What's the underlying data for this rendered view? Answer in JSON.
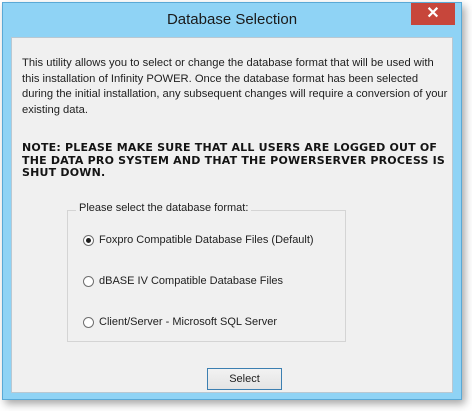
{
  "window": {
    "title": "Database Selection",
    "close_label": "✕"
  },
  "intro": {
    "text": "This utility allows you to select or change the database format that will be used with this installation of Infinity POWER.  Once the database format has been selected during the initial installation, any subsequent changes will require a conversion of your existing data."
  },
  "note": {
    "text": "NOTE: PLEASE MAKE SURE THAT ALL USERS ARE LOGGED OUT OF THE DATA PRO SYSTEM AND THAT THE POWERSERVER PROCESS IS SHUT DOWN."
  },
  "format_group": {
    "label": "Please select the database format:",
    "options": [
      {
        "label": "Foxpro Compatible Database Files (Default)",
        "checked": true
      },
      {
        "label": "dBASE IV Compatible Database Files",
        "checked": false
      },
      {
        "label": "Client/Server - Microsoft SQL Server",
        "checked": false
      }
    ]
  },
  "buttons": {
    "select_label": "Select"
  },
  "colors": {
    "frame": "#8fd3f5",
    "close_button": "#c7463b",
    "client_background": "#f0f0f0"
  }
}
